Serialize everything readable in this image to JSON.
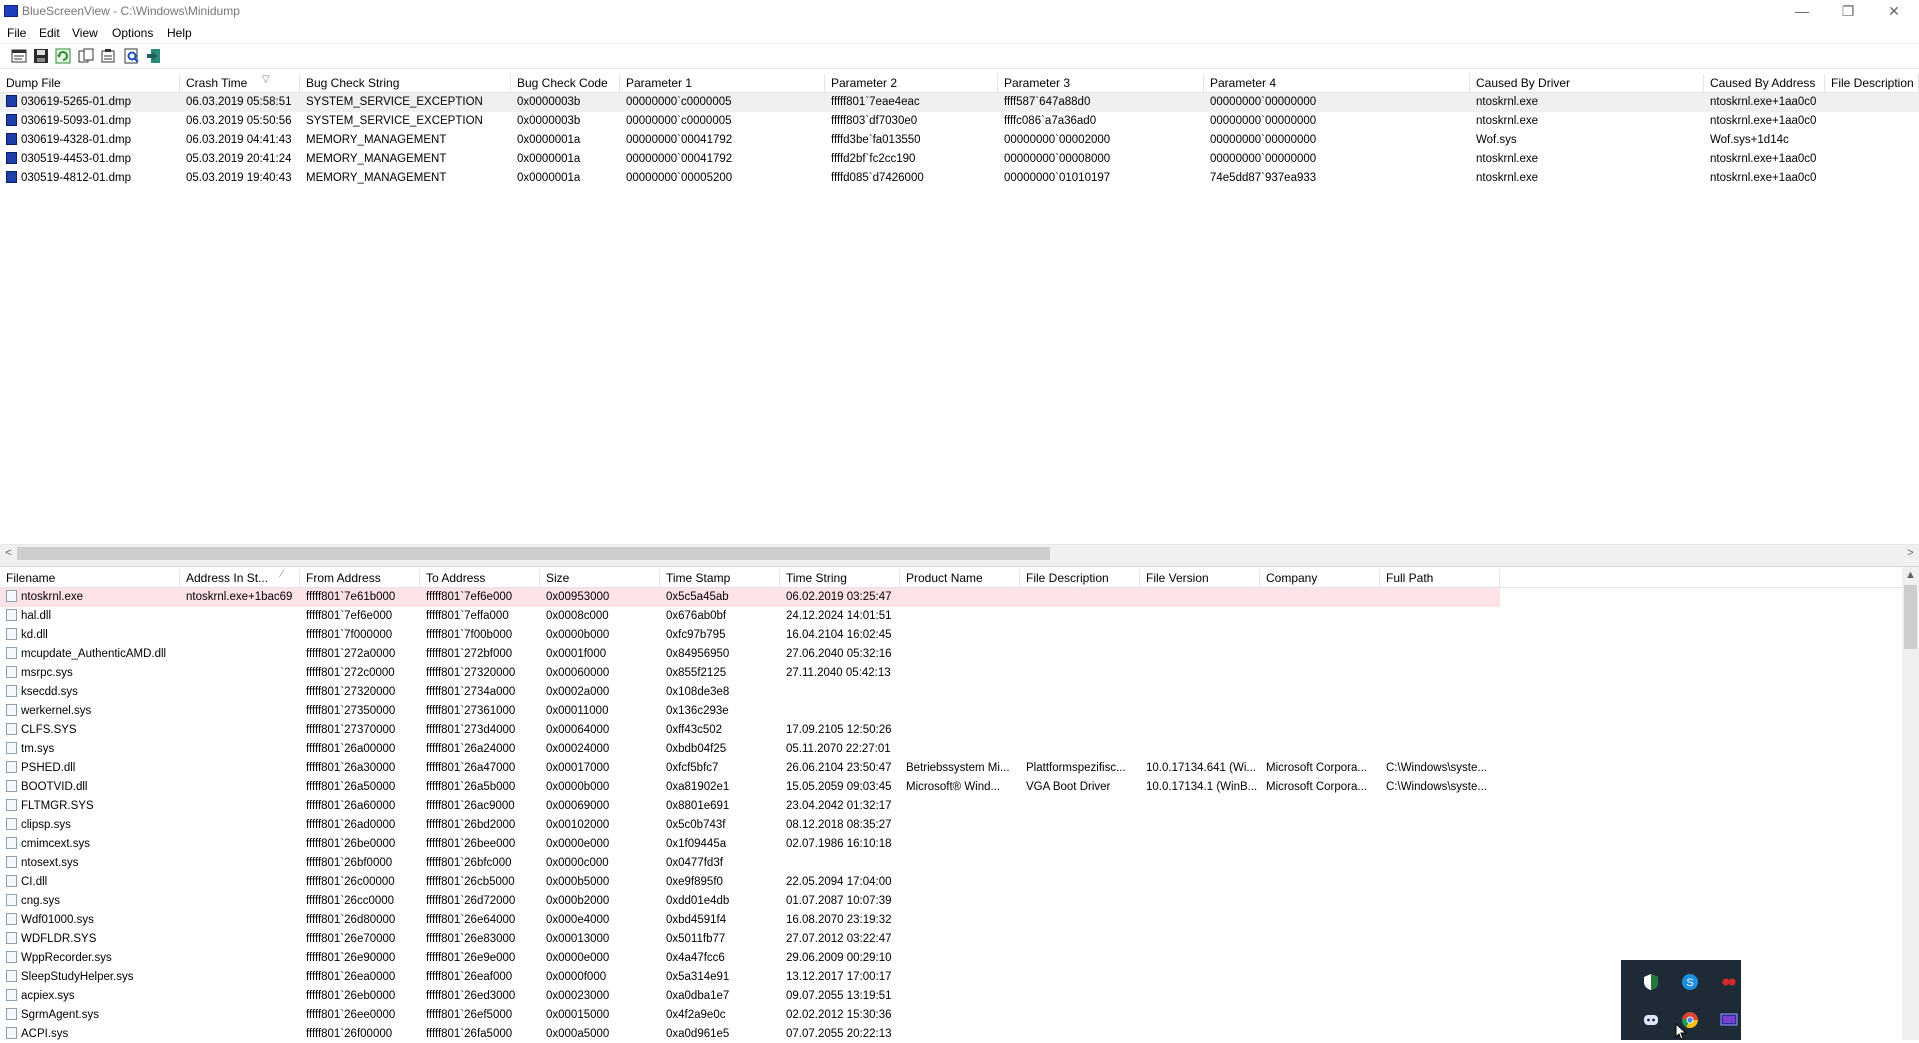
{
  "window": {
    "title": "BlueScreenView - C:\\Windows\\Minidump",
    "controls": {
      "minimize": "—",
      "maximize": "❐",
      "close": "✕"
    }
  },
  "menu": [
    "File",
    "Edit",
    "View",
    "Options",
    "Help"
  ],
  "toolbar": [
    "properties-icon",
    "save-icon",
    "refresh-icon",
    "copy-icon",
    "html-report-icon",
    "find-icon",
    "exit-icon"
  ],
  "top_table": {
    "sorted_by": "Crash Time",
    "columns": [
      "Dump File",
      "Crash Time",
      "Bug Check String",
      "Bug Check Code",
      "Parameter 1",
      "Parameter 2",
      "Parameter 3",
      "Parameter 4",
      "Caused By Driver",
      "Caused By Address",
      "File Description"
    ],
    "rows": [
      [
        "030619-5265-01.dmp",
        "06.03.2019 05:58:51",
        "SYSTEM_SERVICE_EXCEPTION",
        "0x0000003b",
        "00000000`c0000005",
        "fffff801`7eae4eac",
        "ffff587`647a88d0",
        "00000000`00000000",
        "ntoskrnl.exe",
        "ntoskrnl.exe+1aa0c0",
        ""
      ],
      [
        "030619-5093-01.dmp",
        "06.03.2019 05:50:56",
        "SYSTEM_SERVICE_EXCEPTION",
        "0x0000003b",
        "00000000`c0000005",
        "fffff803`df7030e0",
        "ffffc086`a7a36ad0",
        "00000000`00000000",
        "ntoskrnl.exe",
        "ntoskrnl.exe+1aa0c0",
        ""
      ],
      [
        "030619-4328-01.dmp",
        "06.03.2019 04:41:43",
        "MEMORY_MANAGEMENT",
        "0x0000001a",
        "00000000`00041792",
        "ffffd3be`fa013550",
        "00000000`00002000",
        "00000000`00000000",
        "Wof.sys",
        "Wof.sys+1d14c",
        ""
      ],
      [
        "030519-4453-01.dmp",
        "05.03.2019 20:41:24",
        "MEMORY_MANAGEMENT",
        "0x0000001a",
        "00000000`00041792",
        "ffffd2bf`fc2cc190",
        "00000000`00008000",
        "00000000`00000000",
        "ntoskrnl.exe",
        "ntoskrnl.exe+1aa0c0",
        ""
      ],
      [
        "030519-4812-01.dmp",
        "05.03.2019 19:40:43",
        "MEMORY_MANAGEMENT",
        "0x0000001a",
        "00000000`00005200",
        "ffffd085`d7426000",
        "00000000`01010197",
        "74e5dd87`937ea933",
        "ntoskrnl.exe",
        "ntoskrnl.exe+1aa0c0",
        ""
      ]
    ]
  },
  "top_scroll": {
    "left": "<",
    "right": ">"
  },
  "bottom_table": {
    "sorted_by": "Address In Stack",
    "columns": [
      "Filename",
      "Address In St...",
      "From Address",
      "To Address",
      "Size",
      "Time Stamp",
      "Time String",
      "Product Name",
      "File Description",
      "File Version",
      "Company",
      "Full Path"
    ],
    "rows": [
      [
        "ntoskrnl.exe",
        "ntoskrnl.exe+1bac69",
        "fffff801`7e61b000",
        "fffff801`7ef6e000",
        "0x00953000",
        "0x5c5a45ab",
        "06.02.2019 03:25:47",
        "",
        "",
        "",
        "",
        ""
      ],
      [
        "hal.dll",
        "",
        "fffff801`7ef6e000",
        "fffff801`7effa000",
        "0x0008c000",
        "0x676ab0bf",
        "24.12.2024 14:01:51",
        "",
        "",
        "",
        "",
        ""
      ],
      [
        "kd.dll",
        "",
        "fffff801`7f000000",
        "fffff801`7f00b000",
        "0x0000b000",
        "0xfc97b795",
        "16.04.2104 16:02:45",
        "",
        "",
        "",
        "",
        ""
      ],
      [
        "mcupdate_AuthenticAMD.dll",
        "",
        "fffff801`272a0000",
        "fffff801`272bf000",
        "0x0001f000",
        "0x84956950",
        "27.06.2040 05:32:16",
        "",
        "",
        "",
        "",
        ""
      ],
      [
        "msrpc.sys",
        "",
        "fffff801`272c0000",
        "fffff801`27320000",
        "0x00060000",
        "0x855f2125",
        "27.11.2040 05:42:13",
        "",
        "",
        "",
        "",
        ""
      ],
      [
        "ksecdd.sys",
        "",
        "fffff801`27320000",
        "fffff801`2734a000",
        "0x0002a000",
        "0x108de3e8",
        "",
        "",
        "",
        "",
        "",
        ""
      ],
      [
        "werkernel.sys",
        "",
        "fffff801`27350000",
        "fffff801`27361000",
        "0x00011000",
        "0x136c293e",
        "",
        "",
        "",
        "",
        "",
        ""
      ],
      [
        "CLFS.SYS",
        "",
        "fffff801`27370000",
        "fffff801`273d4000",
        "0x00064000",
        "0xff43c502",
        "17.09.2105 12:50:26",
        "",
        "",
        "",
        "",
        ""
      ],
      [
        "tm.sys",
        "",
        "fffff801`26a00000",
        "fffff801`26a24000",
        "0x00024000",
        "0xbdb04f25",
        "05.11.2070 22:27:01",
        "",
        "",
        "",
        "",
        ""
      ],
      [
        "PSHED.dll",
        "",
        "fffff801`26a30000",
        "fffff801`26a47000",
        "0x00017000",
        "0xfcf5bfc7",
        "26.06.2104 23:50:47",
        "Betriebssystem Mi...",
        "Plattformspezifisc...",
        "10.0.17134.641 (Wi...",
        "Microsoft Corpora...",
        "C:\\Windows\\syste..."
      ],
      [
        "BOOTVID.dll",
        "",
        "fffff801`26a50000",
        "fffff801`26a5b000",
        "0x0000b000",
        "0xa81902e1",
        "15.05.2059 09:03:45",
        "Microsoft® Wind...",
        "VGA Boot Driver",
        "10.0.17134.1 (WinB...",
        "Microsoft Corpora...",
        "C:\\Windows\\syste..."
      ],
      [
        "FLTMGR.SYS",
        "",
        "fffff801`26a60000",
        "fffff801`26ac9000",
        "0x00069000",
        "0x8801e691",
        "23.04.2042 01:32:17",
        "",
        "",
        "",
        "",
        ""
      ],
      [
        "clipsp.sys",
        "",
        "fffff801`26ad0000",
        "fffff801`26bd2000",
        "0x00102000",
        "0x5c0b743f",
        "08.12.2018 08:35:27",
        "",
        "",
        "",
        "",
        ""
      ],
      [
        "cmimcext.sys",
        "",
        "fffff801`26be0000",
        "fffff801`26bee000",
        "0x0000e000",
        "0x1f09445a",
        "02.07.1986 16:10:18",
        "",
        "",
        "",
        "",
        ""
      ],
      [
        "ntosext.sys",
        "",
        "fffff801`26bf0000",
        "fffff801`26bfc000",
        "0x0000c000",
        "0x0477fd3f",
        "",
        "",
        "",
        "",
        "",
        ""
      ],
      [
        "CI.dll",
        "",
        "fffff801`26c00000",
        "fffff801`26cb5000",
        "0x000b5000",
        "0xe9f895f0",
        "22.05.2094 17:04:00",
        "",
        "",
        "",
        "",
        ""
      ],
      [
        "cng.sys",
        "",
        "fffff801`26cc0000",
        "fffff801`26d72000",
        "0x000b2000",
        "0xdd01e4db",
        "01.07.2087 10:07:39",
        "",
        "",
        "",
        "",
        ""
      ],
      [
        "Wdf01000.sys",
        "",
        "fffff801`26d80000",
        "fffff801`26e64000",
        "0x000e4000",
        "0xbd4591f4",
        "16.08.2070 23:19:32",
        "",
        "",
        "",
        "",
        ""
      ],
      [
        "WDFLDR.SYS",
        "",
        "fffff801`26e70000",
        "fffff801`26e83000",
        "0x00013000",
        "0x5011fb77",
        "27.07.2012 03:22:47",
        "",
        "",
        "",
        "",
        ""
      ],
      [
        "WppRecorder.sys",
        "",
        "fffff801`26e90000",
        "fffff801`26e9e000",
        "0x0000e000",
        "0x4a47fcc6",
        "29.06.2009 00:29:10",
        "",
        "",
        "",
        "",
        ""
      ],
      [
        "SleepStudyHelper.sys",
        "",
        "fffff801`26ea0000",
        "fffff801`26eaf000",
        "0x0000f000",
        "0x5a314e91",
        "13.12.2017 17:00:17",
        "",
        "",
        "",
        "",
        ""
      ],
      [
        "acpiex.sys",
        "",
        "fffff801`26eb0000",
        "fffff801`26ed3000",
        "0x00023000",
        "0xa0dba1e7",
        "09.07.2055 13:19:51",
        "",
        "",
        "",
        "",
        ""
      ],
      [
        "SgrmAgent.sys",
        "",
        "fffff801`26ee0000",
        "fffff801`26ef5000",
        "0x00015000",
        "0x4f2a9e0c",
        "02.02.2012 15:30:36",
        "",
        "",
        "",
        "",
        ""
      ],
      [
        "ACPI.sys",
        "",
        "fffff801`26f00000",
        "fffff801`26fa5000",
        "0x000a5000",
        "0xa0d961e5",
        "07.07.2055 20:22:13",
        "",
        "",
        "",
        "",
        ""
      ]
    ]
  },
  "tray_popup": [
    "defender-icon",
    "skype-icon",
    "redapp-icon",
    "discord-icon",
    "chrome-icon",
    "monitor-icon"
  ],
  "colors": {
    "highlight_row": "#fde3e8",
    "top_row_bg": "#f0f0f0",
    "tray_bg": "#1e2a36"
  }
}
